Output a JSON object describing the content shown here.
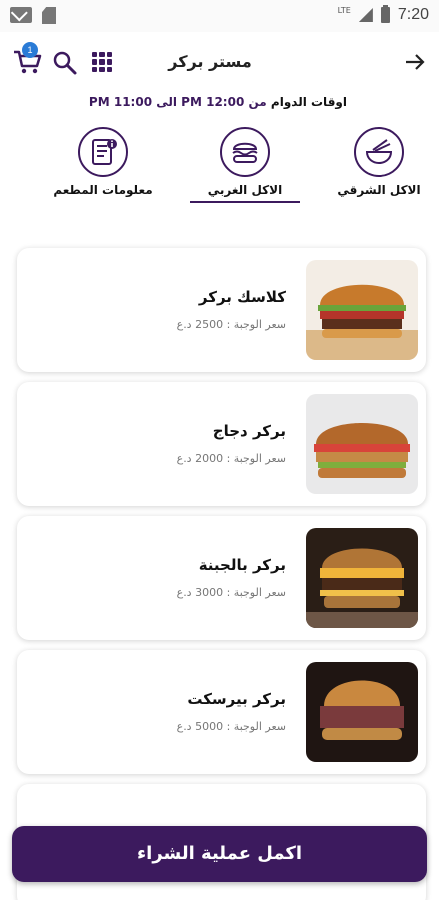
{
  "status_bar": {
    "network": "LTE",
    "time": "7:20"
  },
  "header": {
    "title": "مستر بركر",
    "cart_count": "1",
    "hours_label": "اوقات الدوام",
    "hours_value": "من 12:00 PM الى 11:00 PM"
  },
  "categories": [
    {
      "label": "الاكل الشرقي",
      "icon": "bowl-icon"
    },
    {
      "label": "الاكل الغربي",
      "icon": "burger-icon",
      "active": true
    },
    {
      "label": "معلومات المطعم",
      "icon": "info-document-icon"
    }
  ],
  "items": [
    {
      "name": "كلاسك بركر",
      "price": "سعر الوجبة : 2500 د.ع"
    },
    {
      "name": "بركر دجاج",
      "price": "سعر الوجبة : 2000 د.ع"
    },
    {
      "name": "بركر بالجبنة",
      "price": "سعر الوجبة : 3000 د.ع"
    },
    {
      "name": "بركر بيرسكت",
      "price": "سعر الوجبة : 5000 د.ع"
    }
  ],
  "checkout_label": "اكمل عملية الشراء",
  "colors": {
    "primary": "#3c1a5e",
    "badge": "#2a7bd6"
  }
}
